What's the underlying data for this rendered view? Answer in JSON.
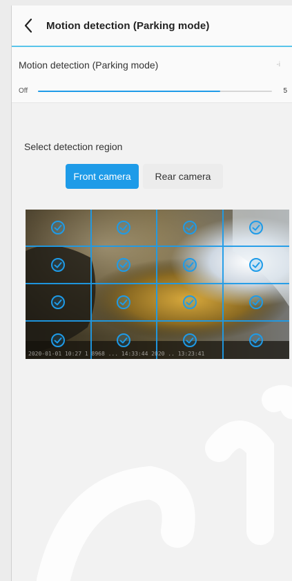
{
  "header": {
    "title": "Motion detection (Parking mode)",
    "back_icon": "chevron-left-icon"
  },
  "sensitivity": {
    "label": "Motion detection (Parking mode)",
    "side_mark": "-i",
    "min_label": "Off",
    "max_label": "5",
    "level_fraction": 0.78
  },
  "region": {
    "label": "Select detection region",
    "tabs": [
      {
        "label": "Front camera",
        "active": true
      },
      {
        "label": "Rear camera",
        "active": false
      }
    ]
  },
  "preview": {
    "overlay_text": "2020-01-01 10:27 1 8968 ... 14:33:44 2020 .. 13:23:41",
    "cells_selected": [
      true,
      true,
      true,
      true,
      true,
      true,
      true,
      true,
      true,
      true,
      true,
      true,
      true,
      true,
      true,
      true
    ],
    "check_icon": "check-circle-icon"
  },
  "colors": {
    "accent": "#1e9be8",
    "header_rule": "#58c4ea",
    "background": "#f2f2f2"
  }
}
